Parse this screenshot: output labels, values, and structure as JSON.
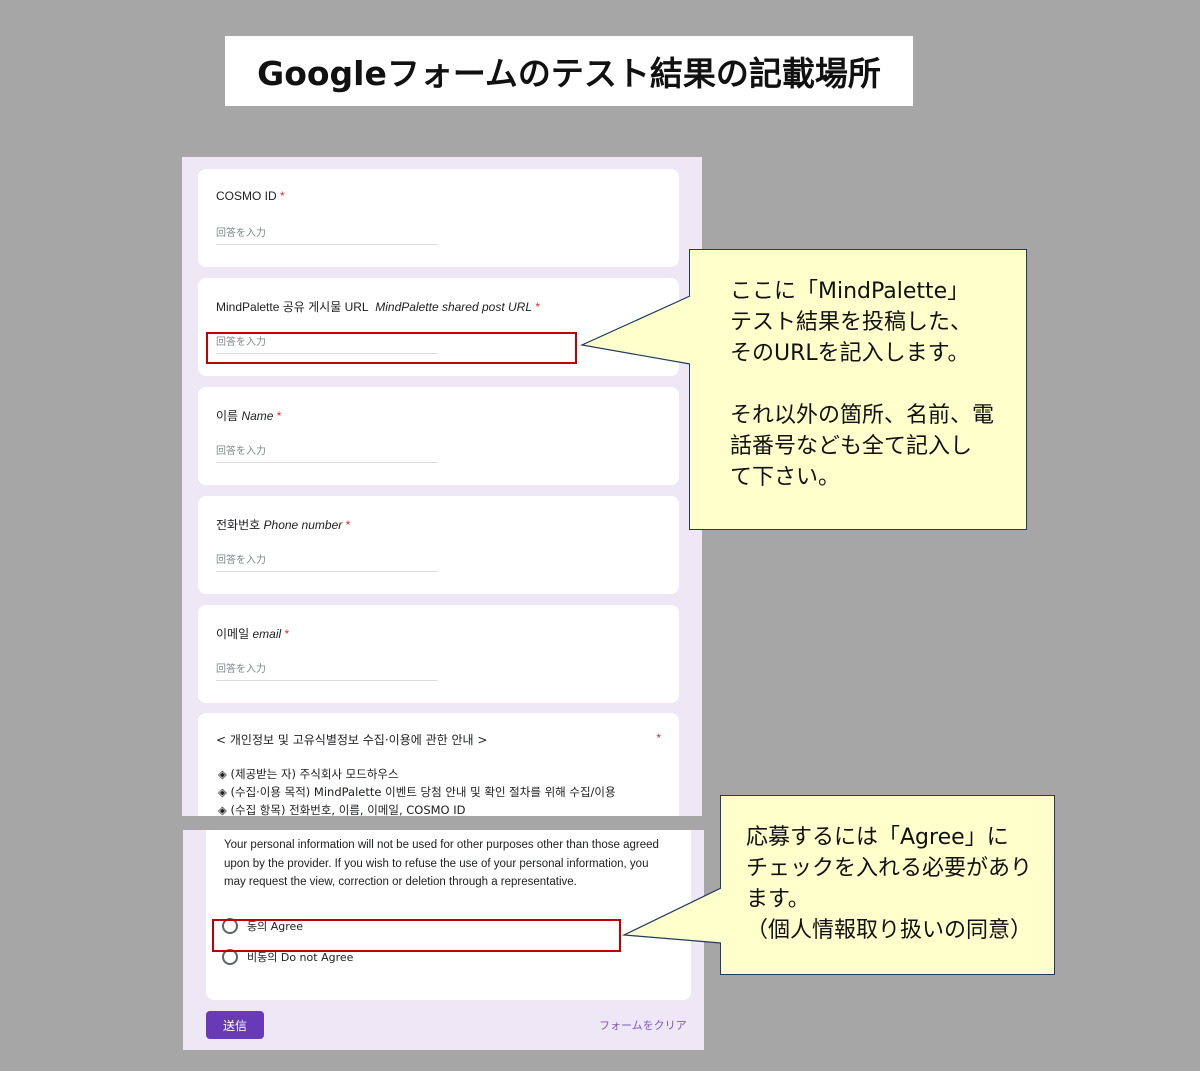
{
  "title": "Googleフォームのテスト結果の記載場所",
  "form": {
    "placeholder": "回答を入力",
    "required_mark": "*",
    "questions": [
      {
        "label": "COSMO ID",
        "label_italic": ""
      },
      {
        "label": "MindPalette 공유 게시물 URL",
        "label_italic": "MindPalette shared post URL"
      },
      {
        "label": "이름",
        "label_italic": "Name"
      },
      {
        "label": "전화번호",
        "label_italic": "Phone number"
      },
      {
        "label": "이메일",
        "label_italic": "email"
      }
    ],
    "privacy": {
      "title": "< 개인정보 및 고유식별정보 수집·이용에 관한 안내 >",
      "lines": [
        "◈ (제공받는 자) 주식회사 모드하우스",
        "◈ (수집·이용 목적) MindPalette 이벤트 당첨 안내 및 확인 절차를 위해 수집/이용",
        "◈ (수집 항목) 전화번호, 이름, 이메일, COSMO ID"
      ],
      "consent_text": "Your personal information will not be used for other purposes other than those agreed upon by the provider. If you wish to refuse the use of your personal information, you may request the view, correction or deletion through a representative.",
      "options": [
        "동의 Agree",
        "비동의 Do not Agree"
      ]
    },
    "submit_label": "送信",
    "clear_label": "フォームをクリア"
  },
  "callouts": {
    "url_note": "ここに「MindPalette」\nテスト結果を投稿した、\nそのURLを記入します。\n\nそれ以外の箇所、名前、電\n話番号なども全て記入し\nて下さい。",
    "agree_note": "応募するには「Agree」に\nチェックを入れる必要があり\nます。\n（個人情報取り扱いの同意）"
  },
  "colors": {
    "background": "#a6a6a6",
    "form_bg": "#ede7f6",
    "accent": "#673ab7",
    "highlight": "#c00000",
    "callout_bg": "#ffffcc"
  }
}
